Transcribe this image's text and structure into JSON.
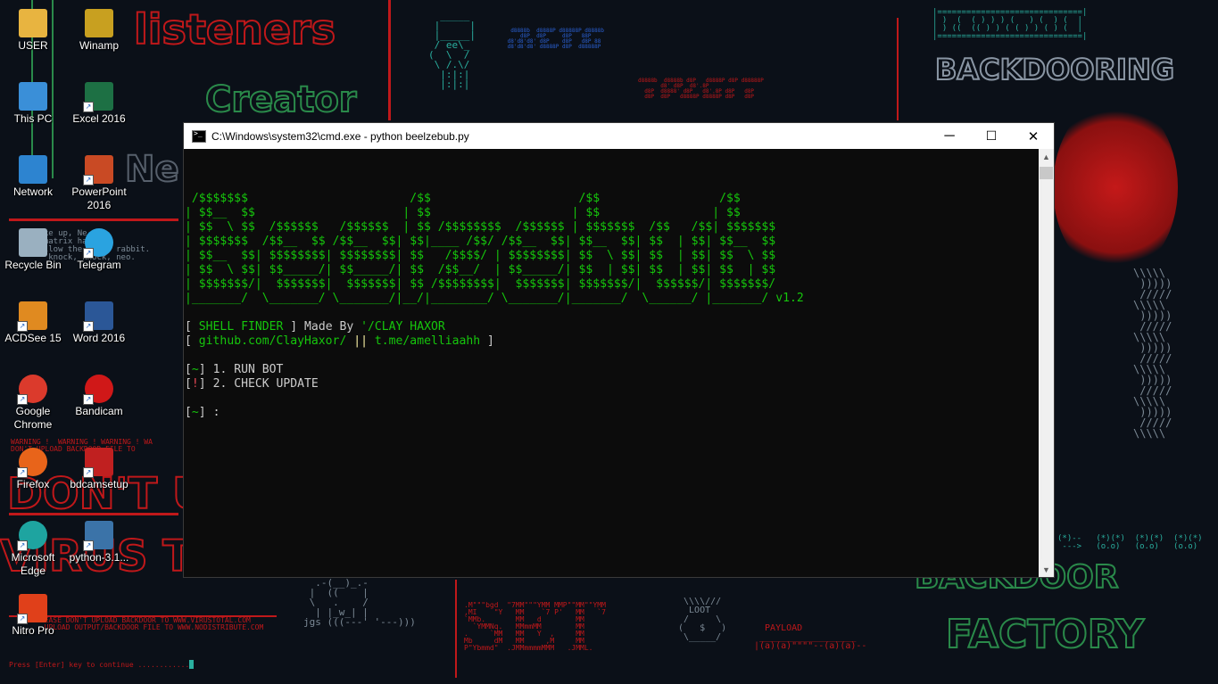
{
  "desktop": {
    "icons": [
      {
        "label": "USER",
        "icon": "user-folder-icon",
        "color": "#e8b440"
      },
      {
        "label": "Winamp",
        "icon": "winamp-icon",
        "color": "#c8a020"
      },
      {
        "label": "This PC",
        "icon": "computer-icon",
        "color": "#3a8fd8"
      },
      {
        "label": "Excel 2016",
        "icon": "excel-icon",
        "color": "#1d7044"
      },
      {
        "label": "Network",
        "icon": "network-icon",
        "color": "#2d84d0"
      },
      {
        "label": "PowerPoint 2016",
        "icon": "powerpoint-icon",
        "color": "#c94a24"
      },
      {
        "label": "Recycle Bin",
        "icon": "recycle-bin-icon",
        "color": "#9ab0c0"
      },
      {
        "label": "Telegram",
        "icon": "telegram-icon",
        "color": "#2aa3e0"
      },
      {
        "label": "ACDSee 15",
        "icon": "acdsee-icon",
        "color": "#e08a20"
      },
      {
        "label": "Word 2016",
        "icon": "word-icon",
        "color": "#2b5797"
      },
      {
        "label": "Google Chrome",
        "icon": "chrome-icon",
        "color": "#db3a2c"
      },
      {
        "label": "Bandicam",
        "icon": "bandicam-icon",
        "color": "#d01818"
      },
      {
        "label": "Firefox",
        "icon": "firefox-icon",
        "color": "#e8641a"
      },
      {
        "label": "bdcamsetup",
        "icon": "bdcam-setup-icon",
        "color": "#c02020"
      },
      {
        "label": "Microsoft Edge",
        "icon": "edge-icon",
        "color": "#1ea4a0"
      },
      {
        "label": "python-3.1...",
        "icon": "python-installer-icon",
        "color": "#3b73a8"
      },
      {
        "label": "Nitro Pro",
        "icon": "nitro-pro-icon",
        "color": "#e0401a"
      }
    ]
  },
  "window": {
    "title": "C:\\Windows\\system32\\cmd.exe - python  beelzebub.py",
    "minimize": "─",
    "maximize": "☐",
    "close": "✕"
  },
  "console": {
    "banner": [
      " /$$$$$$$                       /$$                     /$$                 /$$",
      "| $$__  $$                     | $$                    | $$                | $$",
      "| $$  \\ $$  /$$$$$$   /$$$$$$  | $$ /$$$$$$$$  /$$$$$$ | $$$$$$$  /$$   /$$| $$$$$$$",
      "| $$$$$$$  /$$__  $$ /$$__  $$| $$|____ /$$/ /$$__  $$| $$__  $$| $$  | $$| $$__  $$",
      "| $$__  $$| $$$$$$$$| $$$$$$$$| $$   /$$$$/ | $$$$$$$$| $$  \\ $$| $$  | $$| $$  \\ $$",
      "| $$  \\ $$| $$_____/| $$_____/| $$  /$$__/  | $$_____/| $$  | $$| $$  | $$| $$  | $$",
      "| $$$$$$$/|  $$$$$$$|  $$$$$$$| $$ /$$$$$$$$|  $$$$$$$| $$$$$$$/|  $$$$$$/| $$$$$$$/",
      "|_______/  \\_______/ \\_______/|__/|________/ \\_______/|_______/  \\______/ |_______/"
    ],
    "version": "v1.2",
    "tool_name": "SHELL FINDER",
    "made_by": "Made By",
    "author": "'/CLAY HAXOR",
    "github": "github.com/ClayHaxor/",
    "separator": "||",
    "telegram": "t.me/amelliaahh",
    "menu": [
      {
        "marker": "~",
        "text": "1. RUN BOT"
      },
      {
        "marker": "!",
        "text": "2. CHECK UPDATE"
      }
    ],
    "prompt_marker": "~",
    "prompt_suffix": ":"
  },
  "colors": {
    "console_bg": "#0c0c0c",
    "console_green": "#16c60c",
    "console_red": "#e74856",
    "console_white": "#cccccc",
    "console_yellow": "#f9f1a5"
  }
}
